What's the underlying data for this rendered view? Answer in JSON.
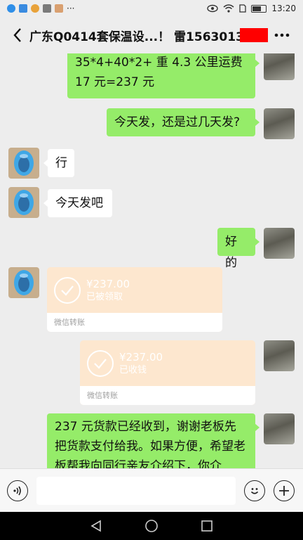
{
  "status_bar": {
    "time": "13:20"
  },
  "header": {
    "title": "广东Q0414套保温设...！ 雷15630137"
  },
  "messages": {
    "m1": "35*4+40*2+ 重 4.3 公里运费 17 元=237 元",
    "m2": "今天发，还是过几天发?",
    "m3": "行",
    "m4": "今天发吧",
    "m5": "好的",
    "t1": {
      "amount": "¥237.00",
      "status": "已被领取",
      "footer": "微信转账"
    },
    "t2": {
      "amount": "¥237.00",
      "status": "已收钱",
      "footer": "微信转账"
    },
    "m6": "237 元货款已经收到，谢谢老板先把货款支付给我。如果方便，希望老板帮我向同行亲友介绍下，你介"
  },
  "icons": {
    "back": "back-icon",
    "more": "more-icon",
    "voice": "voice-icon",
    "emoji": "emoji-icon",
    "plus": "plus-icon",
    "nav_back": "nav-back-icon",
    "nav_home": "nav-home-icon",
    "nav_recent": "nav-recent-icon"
  },
  "colors": {
    "sent_bubble": "#95ec69",
    "received_bubble": "#ffffff",
    "transfer": "#fde7cf",
    "background": "#ededed"
  }
}
